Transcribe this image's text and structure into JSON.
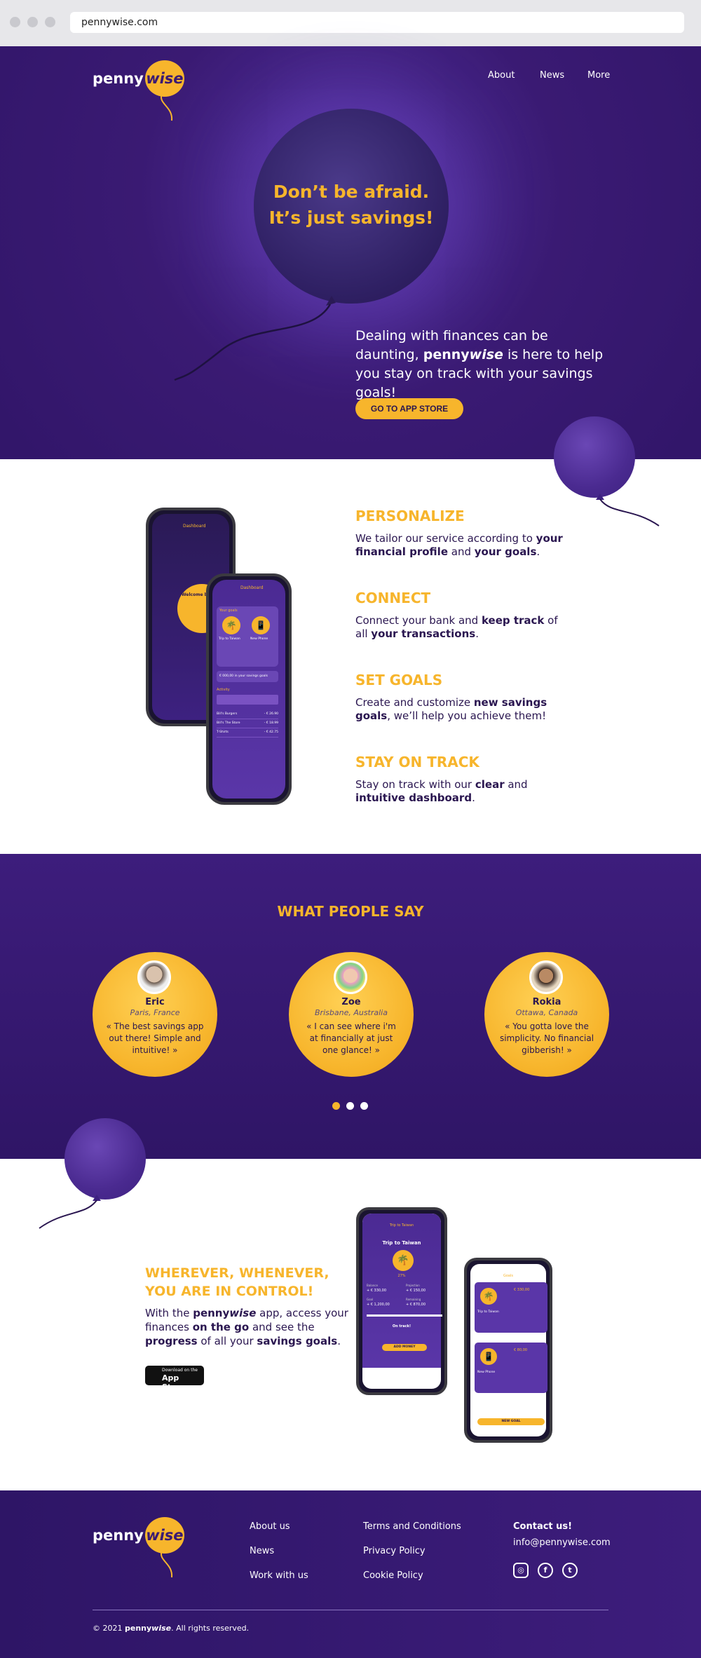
{
  "browser": {
    "url": "pennywise.com"
  },
  "logo": {
    "penny": "penny",
    "wise": "wise"
  },
  "nav": {
    "about": "About",
    "news": "News",
    "more": "More"
  },
  "hero": {
    "title_line1": "Don’t be afraid.",
    "title_line2": "It’s just savings!",
    "text_pre": "Dealing with finances can be daunting,",
    "brand_penny": "penny",
    "brand_wise": "wise",
    "text_post": " is here to help you stay on track with your savings goals!",
    "cta": "GO TO APP STORE"
  },
  "features": [
    {
      "title": "PERSONALIZE",
      "parts": [
        "We tailor our service according to ",
        "your financial profile",
        " and ",
        "your goals",
        "."
      ]
    },
    {
      "title": "CONNECT",
      "parts": [
        "Connect your bank and ",
        "keep track",
        " of all ",
        "your transactions",
        "."
      ]
    },
    {
      "title": "SET GOALS",
      "parts": [
        "Create and customize ",
        "new savings goals",
        ", we’ll help you achieve them!",
        "",
        ""
      ]
    },
    {
      "title": "STAY ON TRACK",
      "parts": [
        "Stay on track with our ",
        "clear",
        " and ",
        "intuitive dashboard",
        "."
      ]
    }
  ],
  "phone1": {
    "header": "Dashboard",
    "welcome": "Welcome back!",
    "your_goals": "Your goals",
    "goal1": "Trip to Taiwan",
    "goal2": "New Phone",
    "savings_goals": "€ 000,00 in your savings goals",
    "activity": "Activity",
    "rows": [
      {
        "name": "Bill's Burgers",
        "amount": "- € 26.90"
      },
      {
        "name": "Bill's The Store",
        "amount": "- € 18.99"
      },
      {
        "name": "T-Shirts",
        "amount": "- € 42.75"
      }
    ]
  },
  "testimonials_title": "WHAT PEOPLE SAY",
  "testimonials": [
    {
      "name": "Eric",
      "location": "Paris, France",
      "quote": "« The best savings app out there! Simple and intuitive! »"
    },
    {
      "name": "Zoe",
      "location": "Brisbane, Australia",
      "quote": "« I can see where i'm at financially at just one glance! »"
    },
    {
      "name": "Rokia",
      "location": "Ottawa, Canada",
      "quote": "« You gotta love the simplicity. No financial gibberish! »"
    }
  ],
  "mobile": {
    "title_line1": "WHEREVER, WHENEVER,",
    "title_line2": "YOU ARE IN CONTROL!",
    "text_parts": [
      "With the ",
      "penny",
      "wise",
      " app, access your finances ",
      "on the go",
      " and see the ",
      "progress",
      " of all your ",
      "savings goals",
      "."
    ],
    "store_small": "Download on the",
    "store_big": "App Store"
  },
  "phone2": {
    "title": "Trip to Taiwan",
    "percent": "27%",
    "balance_label": "Balance",
    "balance": "+ € 330,00",
    "projection_label": "Projection",
    "projection": "+ € 150,00",
    "goal_label": "Goal",
    "goal": "+ € 1,200,00",
    "remaining_label": "Remaining",
    "remaining": "+ € 870,00",
    "on_track": "On track!",
    "add_money": "ADD MONEY"
  },
  "phone3": {
    "header": "Goals",
    "goal1": "Trip to Taiwan",
    "goal1_amount": "€ 330,00",
    "goal2": "New Phone",
    "goal2_amount": "€ 80,00",
    "new_goal": "NEW GOAL"
  },
  "footer": {
    "col1": [
      "About us",
      "News",
      "Work with us"
    ],
    "col2": [
      "Terms and Conditions",
      "Privacy Policy",
      "Cookie Policy"
    ],
    "contact_title": "Contact us!",
    "email": "info@pennywise.com",
    "copyright_pre": "© 2021 ",
    "copyright_brand_penny": "penny",
    "copyright_brand_wise": "wise",
    "copyright_post": ". All rights reserved."
  },
  "colors": {
    "purple": "#3a1a73",
    "yellow": "#f7b52c"
  },
  "icons": [
    "instagram-icon",
    "facebook-icon",
    "twitter-icon",
    "apple-icon",
    "palm-tree-icon",
    "phone-icon"
  ]
}
